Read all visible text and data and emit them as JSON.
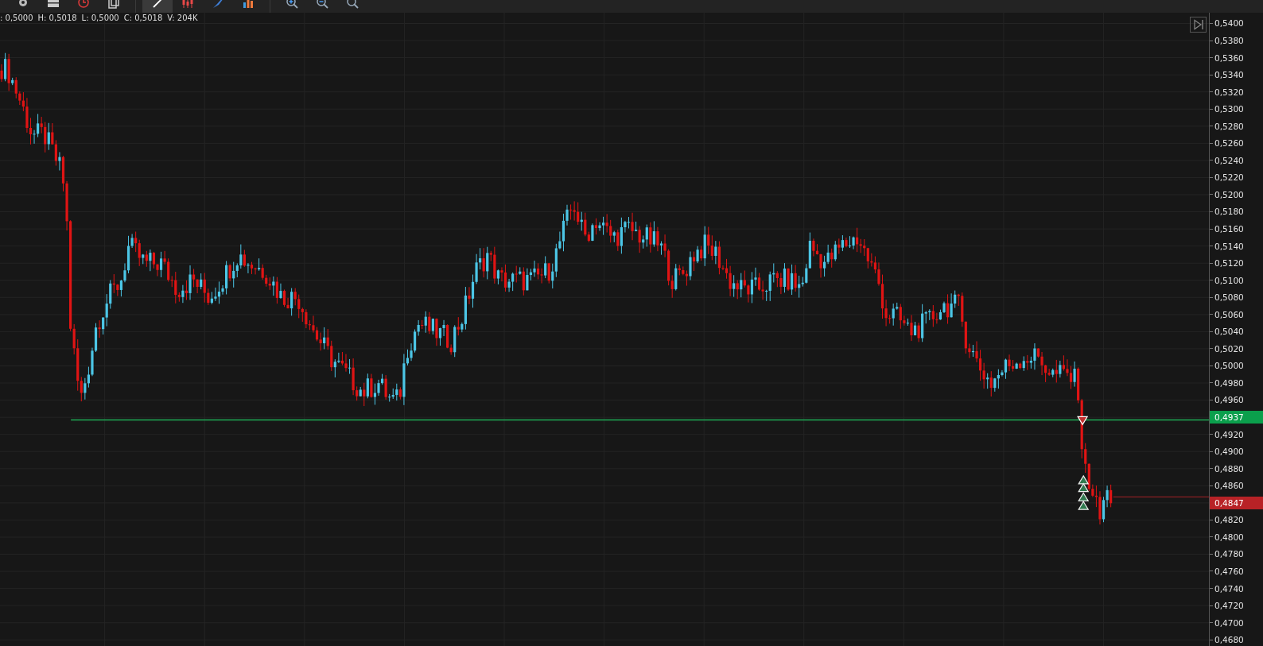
{
  "toolbar": {
    "tools": [
      {
        "selected": false
      },
      {
        "selected": false
      },
      {
        "selected": false
      },
      {
        "selected": false
      },
      {
        "selected": true
      },
      {
        "selected": false
      },
      {
        "selected": false
      },
      {
        "selected": false
      },
      {
        "selected": false
      },
      {
        "selected": false
      },
      {
        "selected": false
      }
    ]
  },
  "ohlc": [
    ": 0,5000",
    "H: 0,5018",
    "L: 0,5000",
    "C: 0,5018",
    "V: 204K"
  ],
  "price_axis": [
    {
      "kind": "tick",
      "label": "0,5400"
    },
    {
      "kind": "tick",
      "label": "0,5380"
    },
    {
      "kind": "tick",
      "label": "0,5360"
    },
    {
      "kind": "tick",
      "label": "0,5340"
    },
    {
      "kind": "tick",
      "label": "0,5320"
    },
    {
      "kind": "tick",
      "label": "0,5300"
    },
    {
      "kind": "tick",
      "label": "0,5280"
    },
    {
      "kind": "tick",
      "label": "0,5260"
    },
    {
      "kind": "tick",
      "label": "0,5240"
    },
    {
      "kind": "tick",
      "label": "0,5220"
    },
    {
      "kind": "tick",
      "label": "0,5200"
    },
    {
      "kind": "tick",
      "label": "0,5180"
    },
    {
      "kind": "tick",
      "label": "0,5160"
    },
    {
      "kind": "tick",
      "label": "0,5140"
    },
    {
      "kind": "tick",
      "label": "0,5120"
    },
    {
      "kind": "tick",
      "label": "0,5100"
    },
    {
      "kind": "tick",
      "label": "0,5080"
    },
    {
      "kind": "tick",
      "label": "0,5060"
    },
    {
      "kind": "tick",
      "label": "0,5040"
    },
    {
      "kind": "tick",
      "label": "0,5020"
    },
    {
      "kind": "tick",
      "label": "0,5000"
    },
    {
      "kind": "tick",
      "label": "0,4980"
    },
    {
      "kind": "tick",
      "label": "0,4960"
    },
    {
      "kind": "tag",
      "label": "0,4937",
      "color": "#0b9f4c"
    },
    {
      "kind": "tick",
      "label": "0,4920"
    },
    {
      "kind": "tick",
      "label": "0,4900"
    },
    {
      "kind": "tick",
      "label": "0,4880"
    },
    {
      "kind": "tick",
      "label": "0,4860"
    },
    {
      "kind": "tag",
      "label": "0,4847",
      "color": "#b82226"
    },
    {
      "kind": "tick",
      "label": "0,4820"
    },
    {
      "kind": "tick",
      "label": "0,4800"
    },
    {
      "kind": "tick",
      "label": "0,4780"
    },
    {
      "kind": "tick",
      "label": "0,4760"
    },
    {
      "kind": "tick",
      "label": "0,4740"
    },
    {
      "kind": "tick",
      "label": "0,4720"
    },
    {
      "kind": "tick",
      "label": "0,4700"
    },
    {
      "kind": "tick",
      "label": "0,4680"
    }
  ]
}
